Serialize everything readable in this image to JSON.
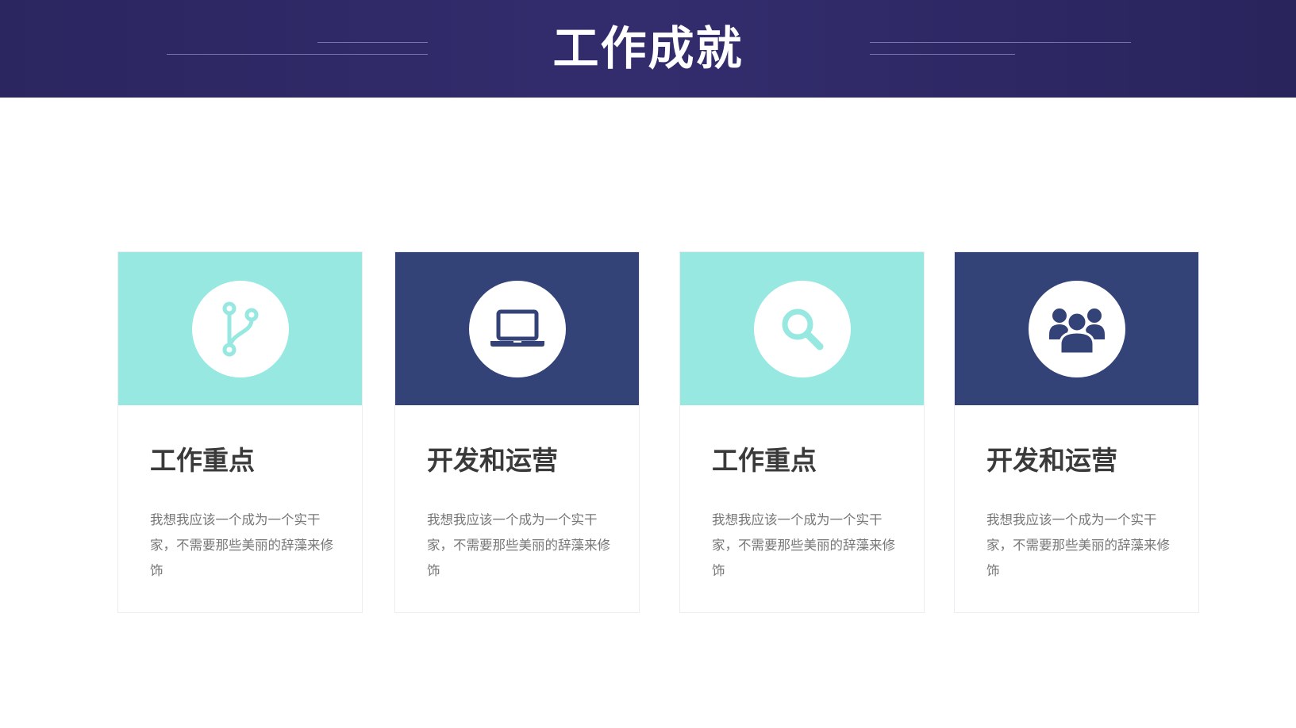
{
  "header": {
    "title": "工作成就",
    "background_color": "#2e2866"
  },
  "colors": {
    "mint": "#96e8e0",
    "navy": "#334277"
  },
  "cards": [
    {
      "title": "工作重点",
      "description": "我想我应该一个成为一个实干家，不需要那些美丽的辞藻来修饰",
      "icon": "code-branch-icon",
      "theme": "mint"
    },
    {
      "title": "开发和运营",
      "description": "我想我应该一个成为一个实干家，不需要那些美丽的辞藻来修饰",
      "icon": "laptop-icon",
      "theme": "navy"
    },
    {
      "title": "工作重点",
      "description": "我想我应该一个成为一个实干家，不需要那些美丽的辞藻来修饰",
      "icon": "search-icon",
      "theme": "mint"
    },
    {
      "title": "开发和运营",
      "description": "我想我应该一个成为一个实干家，不需要那些美丽的辞藻来修饰",
      "icon": "users-icon",
      "theme": "navy"
    }
  ]
}
